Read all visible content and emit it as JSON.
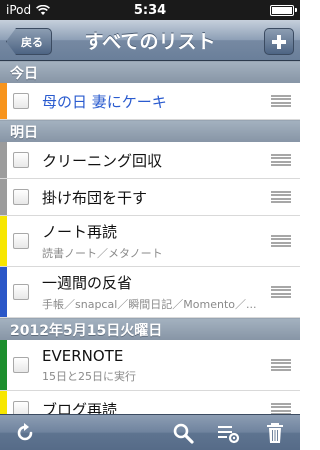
{
  "status": {
    "carrier": "iPod",
    "time": "5:34"
  },
  "nav": {
    "title": "すべてのリスト",
    "back_label": "戻る"
  },
  "colors": {
    "orange": "#f7941d",
    "gray": "#9c9c9c",
    "yellow": "#f7e600",
    "blue": "#2a57c8",
    "green": "#1d8f2e"
  },
  "sections": [
    {
      "header": "今日",
      "rows": [
        {
          "task": "母の日 妻にケーキ",
          "note": "",
          "color": "orange",
          "link": true
        }
      ]
    },
    {
      "header": "明日",
      "rows": [
        {
          "task": "クリーニング回収",
          "note": "",
          "color": "gray",
          "link": false
        },
        {
          "task": "掛け布団を干す",
          "note": "",
          "color": "gray",
          "link": false
        },
        {
          "task": "ノート再読",
          "note": "読書ノート／メタノート",
          "color": "yellow",
          "link": false
        },
        {
          "task": "一週間の反省",
          "note": "手帳／snapcal／瞬間日記／Momento／...",
          "color": "blue",
          "link": false
        }
      ]
    },
    {
      "header": "2012年5月15日火曜日",
      "rows": [
        {
          "task": "EVERNOTE",
          "note": "15日と25日に実行",
          "color": "green",
          "link": false
        },
        {
          "task": "ブログ再読",
          "note": "",
          "color": "yellow",
          "link": false
        }
      ]
    }
  ],
  "toolbar": {
    "refresh_icon": "refresh-icon",
    "search_icon": "search-icon",
    "list_settings_icon": "list-settings-icon",
    "trash_icon": "trash-icon"
  }
}
